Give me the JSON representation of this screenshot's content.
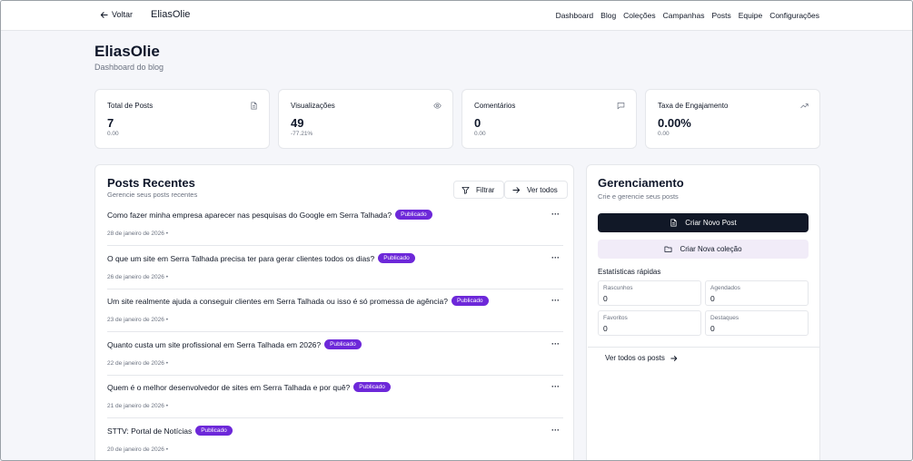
{
  "nav": {
    "back_label": "Voltar",
    "brand": "EliasOlie",
    "links": [
      "Dashboard",
      "Blog",
      "Coleções",
      "Campanhas",
      "Posts",
      "Equipe",
      "Configurações"
    ]
  },
  "header": {
    "title": "EliasOlie",
    "subtitle": "Dashboard do blog"
  },
  "stats": [
    {
      "label": "Total de Posts",
      "value": "7",
      "sub": "0.00",
      "icon": "file-icon"
    },
    {
      "label": "Visualizações",
      "value": "49",
      "sub": "-77.21%",
      "icon": "eye-icon"
    },
    {
      "label": "Comentários",
      "value": "0",
      "sub": "0.00",
      "icon": "message-icon"
    },
    {
      "label": "Taxa de Engajamento",
      "value": "0.00%",
      "sub": "0.00",
      "icon": "trending-up-icon"
    }
  ],
  "posts": {
    "title": "Posts Recentes",
    "subtitle": "Gerencie seus posts recentes",
    "filter_label": "Filtrar",
    "view_all_label": "Ver todos",
    "items": [
      {
        "title": "Como fazer minha empresa aparecer nas pesquisas do Google em Serra Talhada?",
        "status": "Publicado",
        "date": "28 de janeiro de 2026"
      },
      {
        "title": "O que um site em Serra Talhada precisa ter para gerar clientes todos os dias?",
        "status": "Publicado",
        "date": "26 de janeiro de 2026"
      },
      {
        "title": "Um site realmente ajuda a conseguir clientes em Serra Talhada ou isso é só promessa de agência?",
        "status": "Publicado",
        "date": "23 de janeiro de 2026"
      },
      {
        "title": "Quanto custa um site profissional em Serra Talhada em 2026?",
        "status": "Publicado",
        "date": "22 de janeiro de 2026"
      },
      {
        "title": "Quem é o melhor desenvolvedor de sites em Serra Talhada e por quê?",
        "status": "Publicado",
        "date": "21 de janeiro de 2026"
      },
      {
        "title": "STTV: Portal de Notícias",
        "status": "Publicado",
        "date": "20 de janeiro de 2026"
      }
    ]
  },
  "management": {
    "title": "Gerenciamento",
    "subtitle": "Crie e gerencie seus posts",
    "new_post_label": "Criar Novo Post",
    "new_collection_label": "Criar Nova coleção",
    "quick_stats_title": "Estatísticas rápidas",
    "quick_stats": [
      {
        "label": "Rascunhos",
        "value": "0"
      },
      {
        "label": "Agendados",
        "value": "0"
      },
      {
        "label": "Favoritos",
        "value": "0"
      },
      {
        "label": "Destaques",
        "value": "0"
      }
    ],
    "all_posts_label": "Ver todos os posts"
  },
  "colors": {
    "badge": "#6d28d9",
    "primary_button": "#111827",
    "secondary_button": "#f1ecf8"
  }
}
